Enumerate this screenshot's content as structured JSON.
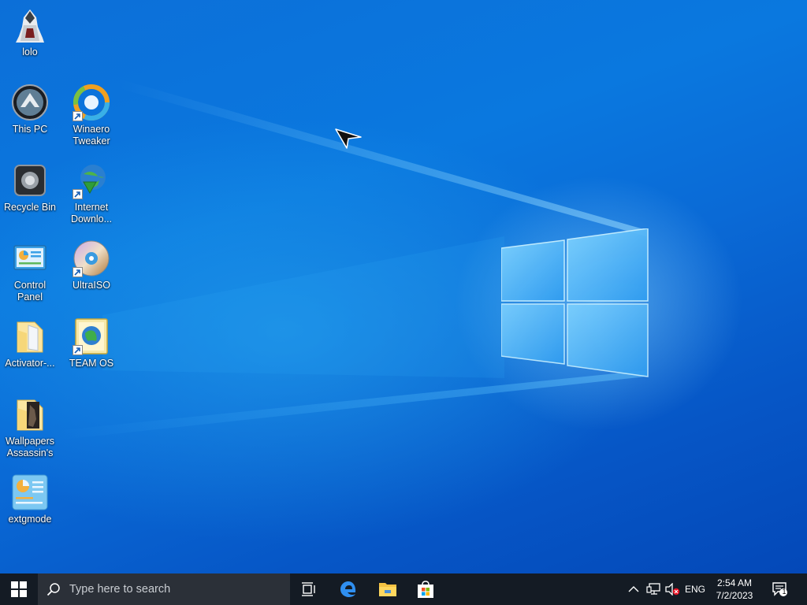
{
  "desktop": {
    "icons": [
      {
        "label": "lolo",
        "icon": "assassin-user-icon"
      },
      {
        "label": "This PC",
        "icon": "this-pc-icon"
      },
      {
        "label": "Winaero Tweaker",
        "icon": "winaero-tweaker-icon"
      },
      {
        "label": "Recycle Bin",
        "icon": "recycle-bin-icon"
      },
      {
        "label": "Internet Downlo...",
        "icon": "internet-download-manager-icon"
      },
      {
        "label": "Control Panel",
        "icon": "control-panel-icon"
      },
      {
        "label": "UltraISO",
        "icon": "ultraiso-disc-icon"
      },
      {
        "label": "Activator-...",
        "icon": "folder-icon"
      },
      {
        "label": "TEAM OS",
        "icon": "team-os-icon"
      },
      {
        "label": "Wallpapers Assassin's",
        "icon": "folder-wallpapers-icon"
      },
      {
        "label": "extgmode",
        "icon": "extgmode-icon"
      }
    ]
  },
  "taskbar": {
    "search_placeholder": "Type here to search",
    "apps": [
      {
        "name": "Task View",
        "icon": "task-view-icon"
      },
      {
        "name": "Microsoft Edge",
        "icon": "edge-icon"
      },
      {
        "name": "File Explorer",
        "icon": "file-explorer-icon"
      },
      {
        "name": "Microsoft Store",
        "icon": "store-icon"
      }
    ],
    "tray": {
      "language": "ENG",
      "time": "2:54 AM",
      "date": "7/2/2023",
      "notification_count": "1"
    }
  },
  "colors": {
    "wallpaper_blue": "#0a6ad6",
    "taskbar": "#141b24",
    "search_box": "#2b3038"
  }
}
